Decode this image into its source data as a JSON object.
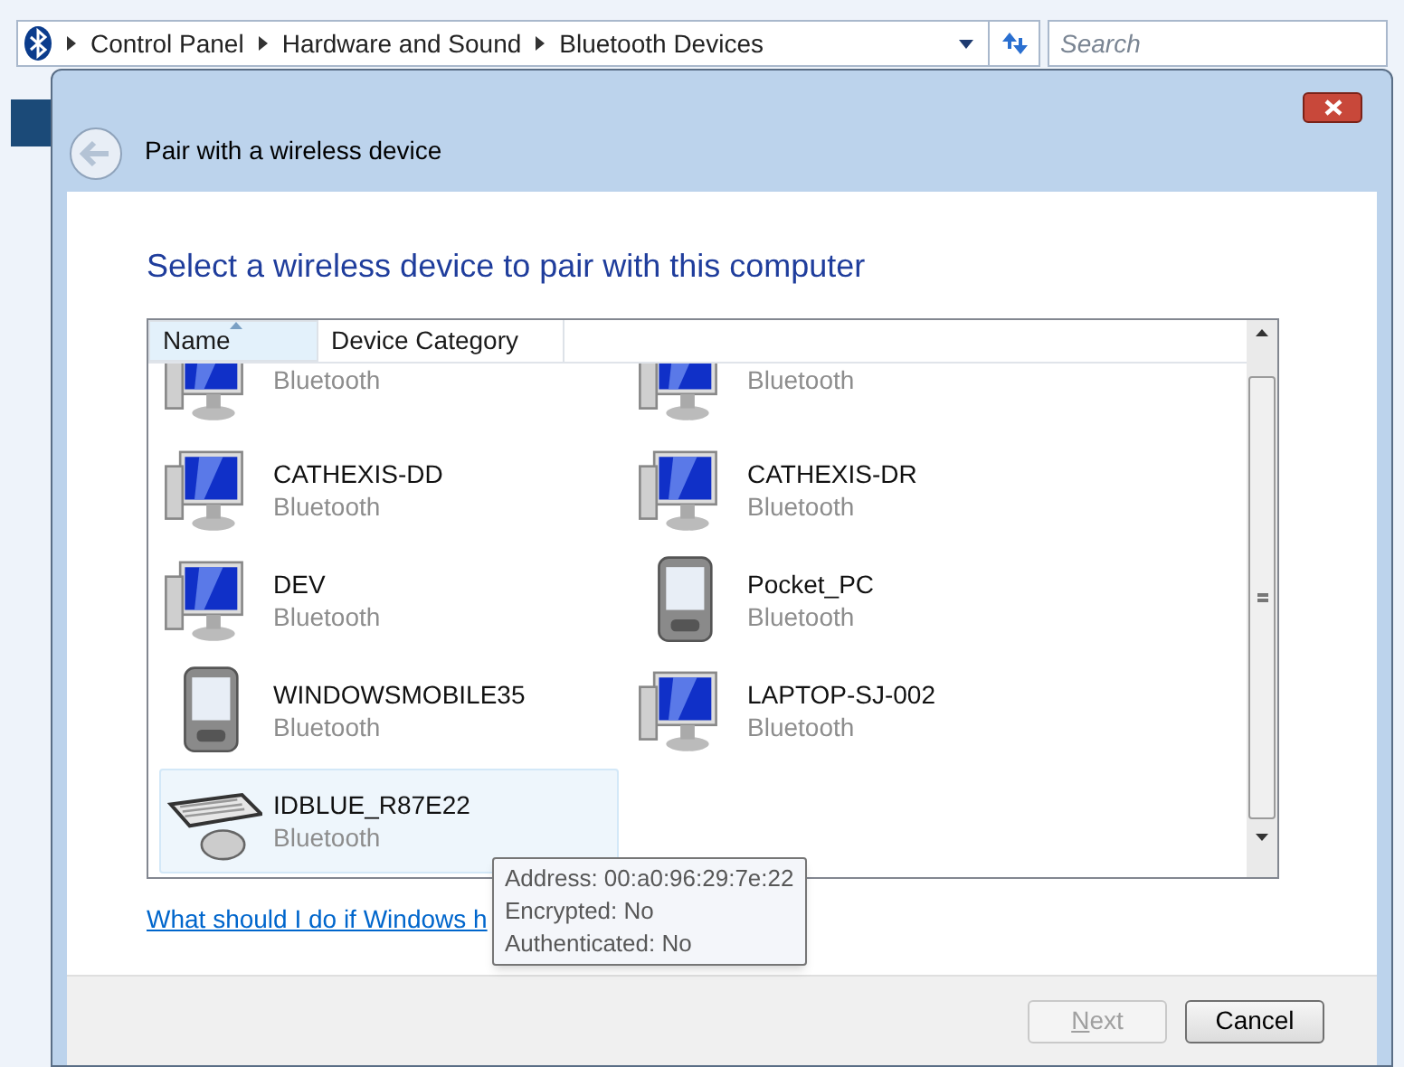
{
  "explorer": {
    "breadcrumb": [
      "Control Panel",
      "Hardware and Sound",
      "Bluetooth Devices"
    ],
    "search": {
      "placeholder": "Search"
    }
  },
  "dialog": {
    "title": "Pair with a wireless device",
    "heading": "Select a wireless device to pair with this computer",
    "columns": [
      {
        "label": "Name",
        "sorted": true
      },
      {
        "label": "Device Category",
        "sorted": false
      }
    ],
    "devices": [
      {
        "kind": "computer",
        "category": "Bluetooth",
        "selected": false
      },
      {
        "kind": "computer",
        "category": "Bluetooth",
        "selected": false
      },
      {
        "kind": "computer",
        "name": "CATHEXIS-DD",
        "category": "Bluetooth",
        "selected": false
      },
      {
        "kind": "computer",
        "name": "CATHEXIS-DR",
        "category": "Bluetooth",
        "selected": false
      },
      {
        "kind": "computer",
        "name": "DEV",
        "category": "Bluetooth",
        "selected": false
      },
      {
        "kind": "pda",
        "name": "Pocket_PC",
        "category": "Bluetooth",
        "selected": false
      },
      {
        "kind": "pda",
        "name": "WINDOWSMOBILE35",
        "category": "Bluetooth",
        "selected": false
      },
      {
        "kind": "computer",
        "name": "LAPTOP-SJ-002",
        "category": "Bluetooth",
        "selected": false
      },
      {
        "kind": "keyboard",
        "name": "IDBLUE_R87E22",
        "category": "Bluetooth",
        "selected": true
      }
    ],
    "tooltip": [
      "Address: 00:a0:96:29:7e:22",
      "Encrypted: No",
      "Authenticated: No"
    ],
    "help_link": "What should I do if Windows h",
    "buttons": [
      {
        "label": "Next",
        "disabled": true
      },
      {
        "label": "Cancel",
        "disabled": false
      }
    ]
  }
}
